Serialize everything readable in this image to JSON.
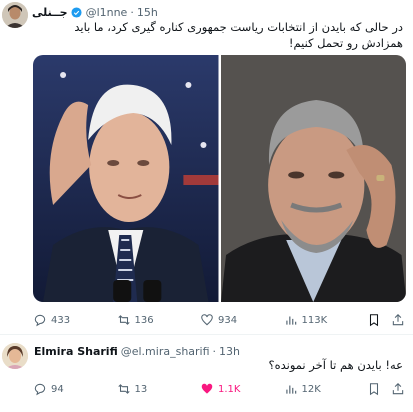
{
  "tweet1": {
    "display_name": "جــنلی",
    "handle": "@l1nne",
    "dot": "·",
    "time": "15h",
    "text": "در حالی که بایدن از انتخابات ریاست جمهوری کناره گیری کرد، ما باید همزادش رو تحمل کنیم!",
    "stats": {
      "replies": "433",
      "reposts": "136",
      "likes": "934",
      "views": "113K"
    }
  },
  "tweet2": {
    "display_name": "Elmira Sharifi",
    "handle": "@el.mira_sharifi",
    "dot": "·",
    "time": "13h",
    "text": "عه! بایدن هم تا آخر نمونده؟",
    "stats": {
      "replies": "94",
      "reposts": "13",
      "likes": "1.1K",
      "views": "12K"
    }
  },
  "colors": {
    "accent": "#1d9bf0",
    "like": "#f91880",
    "muted": "#536471"
  },
  "icons": [
    "verified-badge-icon",
    "reply-icon",
    "repost-icon",
    "like-icon",
    "views-icon",
    "bookmark-icon",
    "share-icon"
  ]
}
